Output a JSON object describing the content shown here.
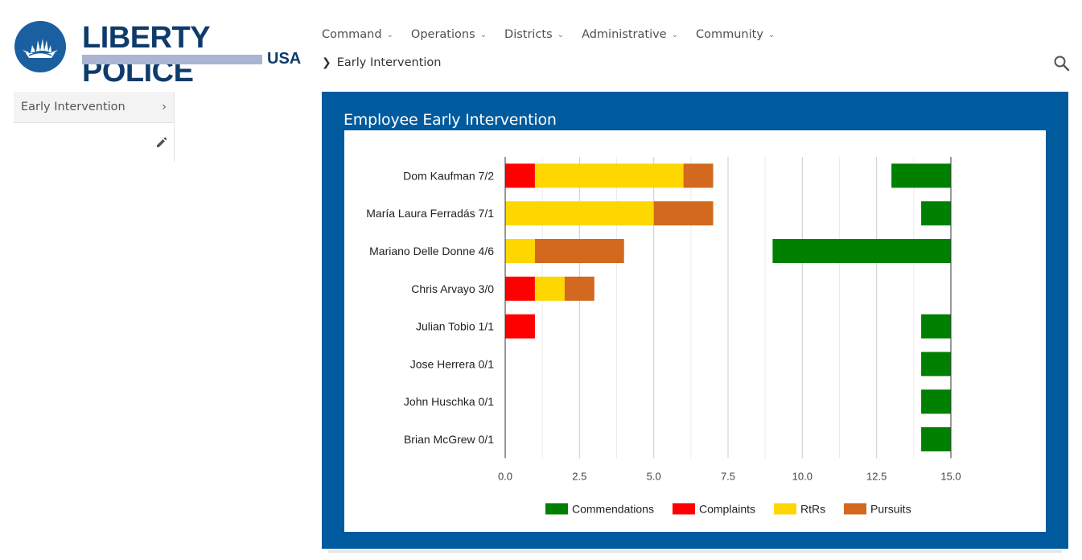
{
  "brand": {
    "title": "LIBERTY POLICE",
    "subtitle": "USA"
  },
  "nav": {
    "items": [
      "Command",
      "Operations",
      "Districts",
      "Administrative",
      "Community"
    ]
  },
  "breadcrumb": {
    "current": "Early Intervention"
  },
  "sidebar": {
    "items": [
      {
        "label": "Early Intervention"
      }
    ]
  },
  "panel": {
    "title": "Employee Early Intervention"
  },
  "icons": {
    "search": "search-icon",
    "edit": "pencil-icon",
    "chevron": "chevron-down-icon"
  },
  "chart_data": {
    "type": "bar",
    "orientation": "horizontal",
    "stacked": true,
    "categories": [
      "Dom Kaufman 7/2",
      "María Laura Ferradás 7/1",
      "Mariano Delle Donne 4/6",
      "Chris Arvayo 3/0",
      "Julian Tobio 1/1",
      "Jose Herrera 0/1",
      "John Huschka 0/1",
      "Brian McGrew 0/1"
    ],
    "series": [
      {
        "name": "Complaints",
        "color": "#ff0000",
        "values": [
          1,
          0,
          0,
          1,
          1,
          0,
          0,
          0
        ]
      },
      {
        "name": "RtRs",
        "color": "#ffd700",
        "values": [
          5,
          5,
          1,
          1,
          0,
          0,
          0,
          0
        ]
      },
      {
        "name": "Pursuits",
        "color": "#d2691e",
        "values": [
          1,
          2,
          3,
          1,
          0,
          0,
          0,
          0
        ]
      },
      {
        "name": "Commendations",
        "color": "#008000",
        "values": [
          2,
          1,
          6,
          0,
          1,
          1,
          1,
          1
        ],
        "anchored_at_max": true
      }
    ],
    "legend_order": [
      "Commendations",
      "Complaints",
      "RtRs",
      "Pursuits"
    ],
    "xlim": [
      0,
      15
    ],
    "xticks": [
      "0.0",
      "2.5",
      "5.0",
      "7.5",
      "10.0",
      "12.5",
      "15.0"
    ],
    "grid": true,
    "legend_position": "bottom"
  }
}
